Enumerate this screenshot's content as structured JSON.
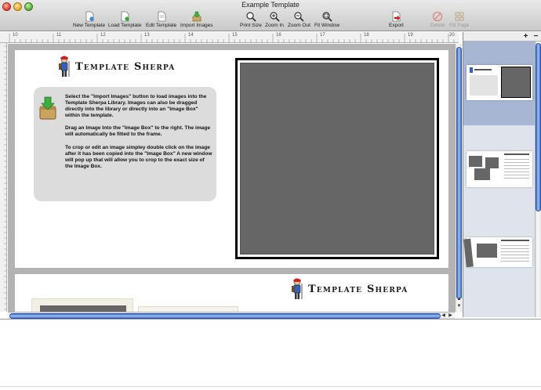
{
  "window": {
    "title": "Example Template"
  },
  "toolbar": {
    "new_template": "New Template",
    "load_template": "Load Template",
    "edit_template": "Edit Template",
    "import_images": "Import Images",
    "print_size": "Print Size",
    "zoom_in": "Zoom In",
    "zoom_out": "Zoom Out",
    "fit_window": "Fit Window",
    "export": "Export",
    "delete": "Delete",
    "fill_page": "Fill Page"
  },
  "ruler": {
    "ticks": [
      "10",
      "11",
      "12",
      "13",
      "14",
      "15",
      "16",
      "17",
      "18",
      "19",
      "20"
    ]
  },
  "template": {
    "logo_text": "Template Sherpa",
    "instructions": [
      "Select the \"Import Images\" button to load images into the Template Sherpa Library.  Images can also be dragged directly into the library or directly into an \"Image Box\" within the template.",
      "Drag an Image Into the \"Image Box\" to the right.   The image will automatically be fitted to the frame.",
      "To crop or edit an image simpley double click on the image after it has been copied into the \"Image Box\"  A new window will pop up that will allow you to crop to the exact size of the Image Box."
    ],
    "page2_logo_text": "Template Sherpa"
  },
  "side_panel": {
    "add_label": "+",
    "remove_label": "−"
  },
  "colors": {
    "image_box": "#666666",
    "selection": "#a7b7d3",
    "scroll_accent": "#4a78d4"
  }
}
